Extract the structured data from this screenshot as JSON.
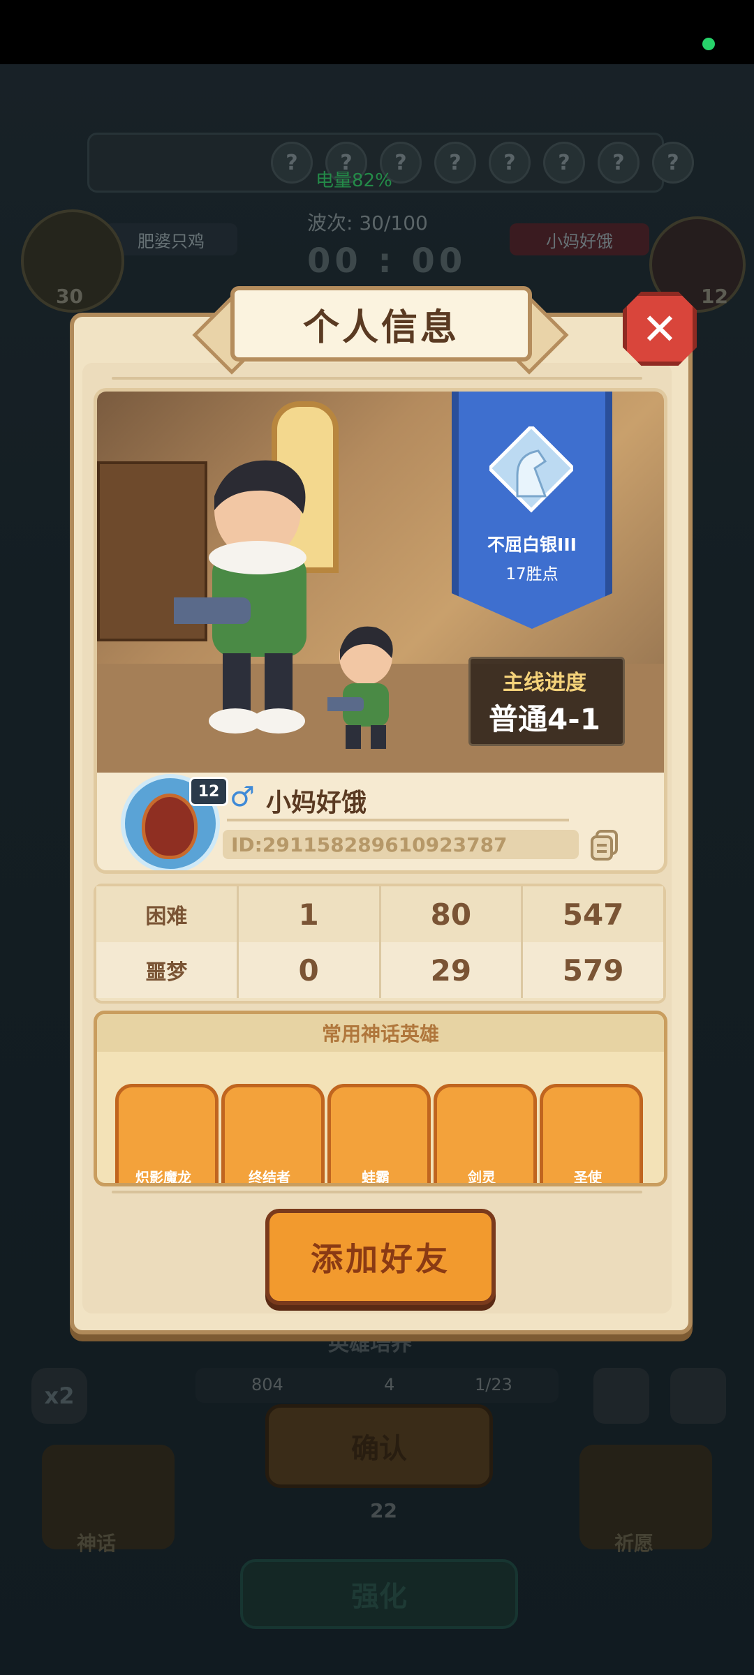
{
  "status_bar": {
    "battery_text": "电量82%"
  },
  "background": {
    "hero_slots": [
      "?",
      "?",
      "?",
      "?",
      "?",
      "?",
      "?",
      "?"
    ],
    "left_player_label": "肥婆只鸡",
    "right_player_label": "小妈好饿",
    "wave_text": "波次: 30/100",
    "timer_text": "00 : 00",
    "left_level": "30",
    "right_level": "12",
    "bottom_title": "英雄培养",
    "x2_label": "x2",
    "resource_1": "804",
    "resource_2": "4",
    "resource_3": "1/23",
    "confirm_label": "确认",
    "confirm_count": "22",
    "myth_label": "神话",
    "pray_label": "祈愿",
    "enhance_label": "强化"
  },
  "modal": {
    "title": "个人信息",
    "close_icon": "close-icon",
    "rank": {
      "name": "不屈白银III",
      "wins": "17胜点"
    },
    "main_progress": {
      "label": "主线进度",
      "value": "普通4-1"
    },
    "player": {
      "level": "12",
      "gender_symbol": "♂",
      "name": "小妈好饿",
      "id_text": "ID:291158289610923787"
    },
    "stats": [
      {
        "mode": "困难",
        "values": [
          "1",
          "80",
          "547"
        ]
      },
      {
        "mode": "噩梦",
        "values": [
          "0",
          "29",
          "579"
        ]
      }
    ],
    "heroes": {
      "title": "常用神话英雄",
      "items": [
        {
          "name": "炽影魔龙"
        },
        {
          "name": "终结者"
        },
        {
          "name": "蛙霸"
        },
        {
          "name": "剑灵"
        },
        {
          "name": "圣使"
        }
      ]
    },
    "add_friend_label": "添加好友"
  },
  "colors": {
    "modal_bg": "#f1e3c4",
    "close_red": "#d9453b",
    "button_orange": "#f29a2e",
    "rank_blue": "#3e6fcf"
  }
}
